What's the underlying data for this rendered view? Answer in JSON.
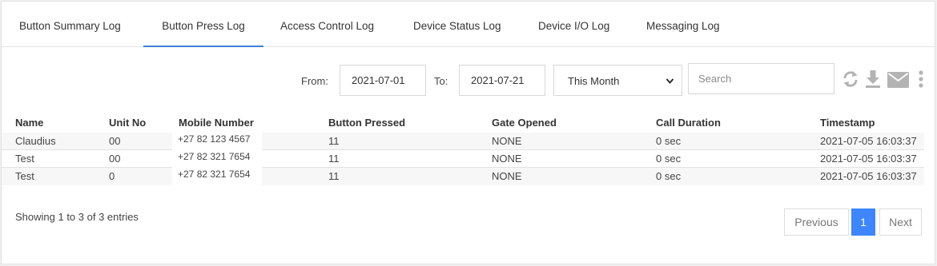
{
  "tabs": [
    {
      "label": "Button Summary Log"
    },
    {
      "label": "Button Press Log"
    },
    {
      "label": "Access Control Log"
    },
    {
      "label": "Device Status Log"
    },
    {
      "label": "Device I/O Log"
    },
    {
      "label": "Messaging Log"
    }
  ],
  "active_tab": "Button Press Log",
  "filters": {
    "from_label": "From:",
    "from_value": "2021-07-01",
    "to_label": "To:",
    "to_value": "2021-07-21",
    "period": "This Month",
    "search_placeholder": "Search"
  },
  "toolbar_icons": [
    "refresh-icon",
    "download-icon",
    "email-icon",
    "more-vertical-icon"
  ],
  "colors": {
    "accent": "#3d86ff",
    "icon": "#b3b3b3",
    "tab_underline": "#3d7fd9"
  },
  "table": {
    "columns": [
      "Name",
      "Unit No",
      "Mobile Number",
      "Button Pressed",
      "Gate Opened",
      "Call Duration",
      "Timestamp"
    ],
    "rows": [
      {
        "name": "Claudius",
        "unit": "00",
        "mobile": "+27 82 123 4567",
        "button": "11",
        "gate": "NONE",
        "duration": "0 sec",
        "timestamp": "2021-07-05 16:03:37"
      },
      {
        "name": "Test",
        "unit": "00",
        "mobile": "+27 82 321 7654",
        "button": "11",
        "gate": "NONE",
        "duration": "0 sec",
        "timestamp": "2021-07-05 16:03:37"
      },
      {
        "name": "Test",
        "unit": "0",
        "mobile": "+27 82 321 7654",
        "button": "11",
        "gate": "NONE",
        "duration": "0 sec",
        "timestamp": "2021-07-05 16:03:37"
      }
    ]
  },
  "info_text": "Showing 1 to 3 of 3 entries",
  "pagination": {
    "previous": "Previous",
    "current": "1",
    "next": "Next"
  }
}
